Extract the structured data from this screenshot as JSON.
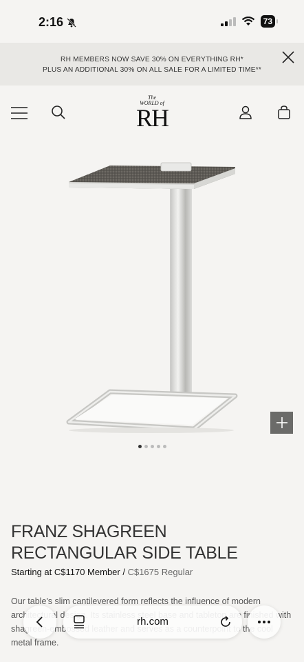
{
  "status_bar": {
    "time": "2:16",
    "battery": "73"
  },
  "promo": {
    "line1": "RH MEMBERS NOW SAVE 30% ON EVERYTHING RH*",
    "line2": "PLUS AN ADDITIONAL 30% ON ALL SALE FOR A LIMITED TIME**"
  },
  "header": {
    "logo_small_1": "The",
    "logo_small_2": "WORLD of",
    "logo_main": "RH"
  },
  "gallery": {
    "dot_count": 5,
    "active_dot": 0
  },
  "product": {
    "title": "FRANZ SHAGREEN RECTANGULAR SIDE TABLE",
    "starting_at": "Starting at C$1170 Member",
    "separator": " / ",
    "regular_price": "C$1675 Regular",
    "description": "Our table's slim cantilevered form reflects the influence of modern architectural design. Its stainless steel base and tabletop are finished with shagreen-embossed leather and serves as a counterpoint to the cool metal frame."
  },
  "browser": {
    "url": "rh.com"
  },
  "colors": {
    "background": "#f5f4f2",
    "promo_bg": "#e9e8e5",
    "plus_button": "#6b6b69"
  }
}
